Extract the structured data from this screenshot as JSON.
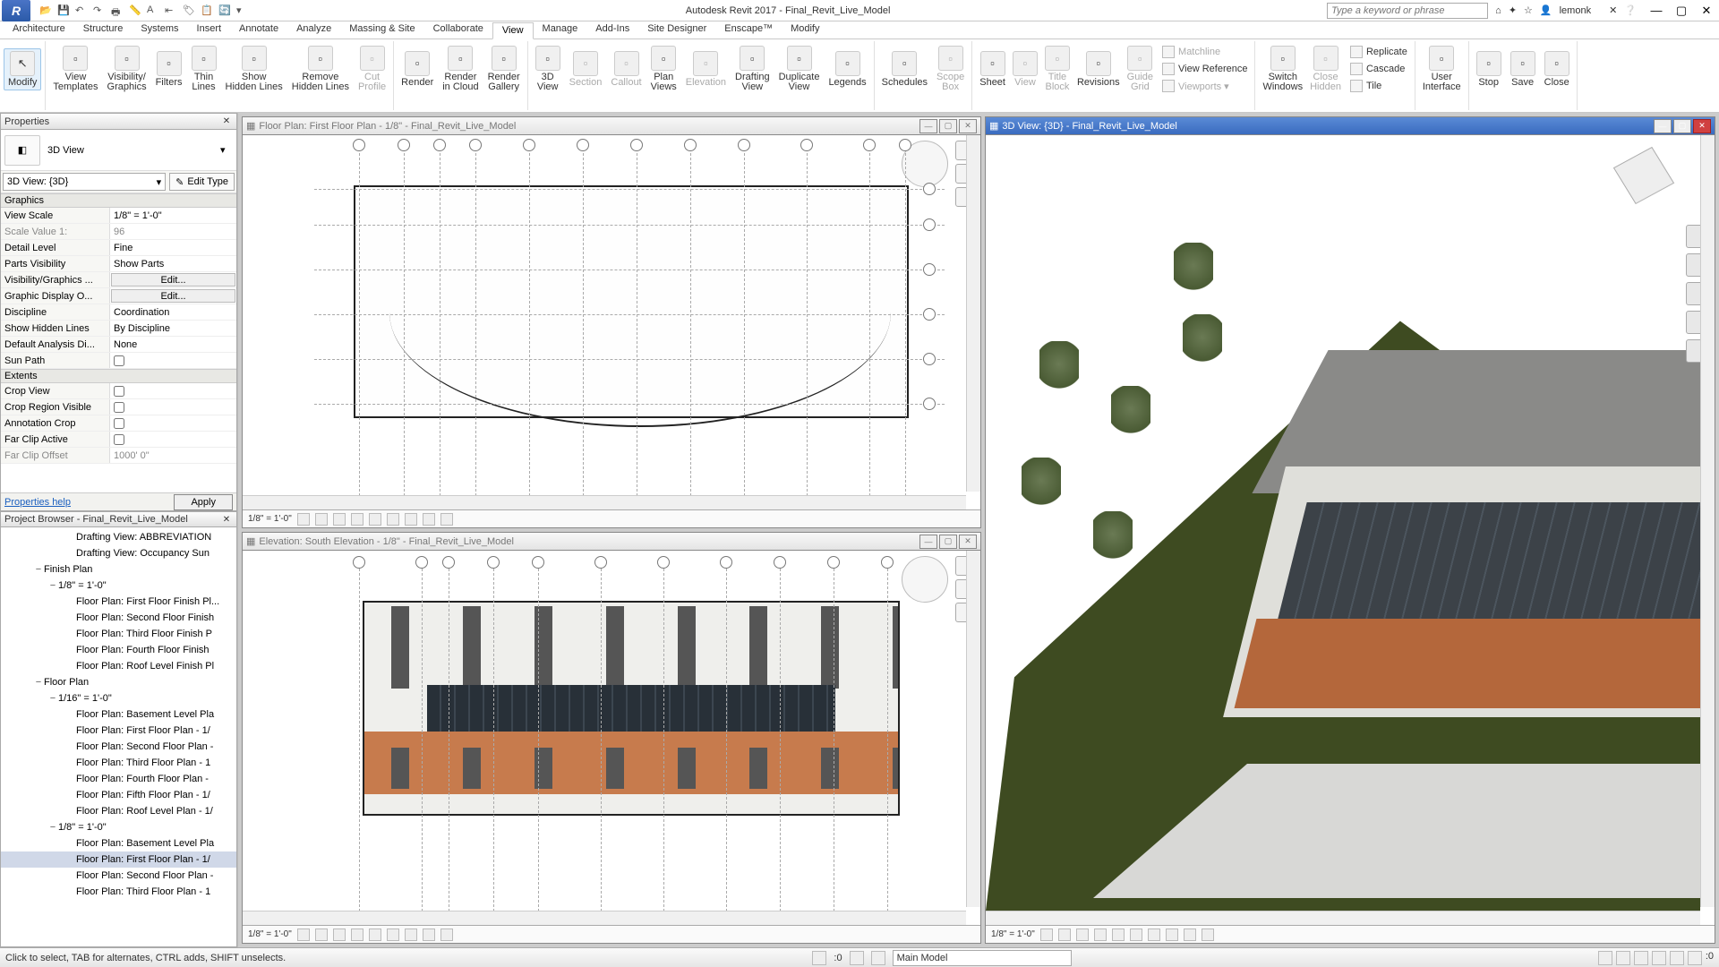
{
  "titlebar": {
    "app_title": "Autodesk Revit 2017 -    Final_Revit_Live_Model",
    "search_placeholder": "Type a keyword or phrase",
    "username": "lemonk"
  },
  "qat_icons": [
    "open-icon",
    "save-icon",
    "undo-icon",
    "redo-icon",
    "print-icon",
    "measure-icon",
    "text-icon",
    "aligned-dim-icon",
    "tag-icon",
    "paste-icon",
    "sync-icon",
    "dropdown-icon"
  ],
  "menutabs": [
    "Architecture",
    "Structure",
    "Systems",
    "Insert",
    "Annotate",
    "Analyze",
    "Massing & Site",
    "Collaborate",
    "View",
    "Manage",
    "Add-Ins",
    "Site Designer",
    "Enscape™",
    "Modify"
  ],
  "active_tab": "View",
  "ribbon": {
    "modify": "Modify",
    "graphics": [
      {
        "label": "View\nTemplates",
        "name": "view-templates"
      },
      {
        "label": "Visibility/\nGraphics",
        "name": "visibility-graphics"
      },
      {
        "label": "Filters",
        "name": "filters"
      },
      {
        "label": "Thin\nLines",
        "name": "thin-lines"
      },
      {
        "label": "Show\nHidden Lines",
        "name": "show-hidden-lines"
      },
      {
        "label": "Remove\nHidden Lines",
        "name": "remove-hidden-lines"
      },
      {
        "label": "Cut\nProfile",
        "name": "cut-profile",
        "disabled": true
      }
    ],
    "presentation": [
      {
        "label": "Render",
        "name": "render"
      },
      {
        "label": "Render\nin Cloud",
        "name": "render-in-cloud"
      },
      {
        "label": "Render\nGallery",
        "name": "render-gallery"
      }
    ],
    "create1": [
      {
        "label": "3D\nView",
        "name": "3d-view"
      },
      {
        "label": "Section",
        "name": "section",
        "disabled": true
      },
      {
        "label": "Callout",
        "name": "callout",
        "disabled": true
      },
      {
        "label": "Plan\nViews",
        "name": "plan-views"
      },
      {
        "label": "Elevation",
        "name": "elevation",
        "disabled": true
      },
      {
        "label": "Drafting\nView",
        "name": "drafting-view"
      },
      {
        "label": "Duplicate\nView",
        "name": "duplicate-view"
      },
      {
        "label": "Legends",
        "name": "legends"
      }
    ],
    "create2": [
      {
        "label": "Schedules",
        "name": "schedules"
      },
      {
        "label": "Scope\nBox",
        "name": "scope-box",
        "disabled": true
      }
    ],
    "sheet": [
      {
        "label": "Sheet",
        "name": "sheet"
      },
      {
        "label": "View",
        "name": "view-place",
        "disabled": true
      },
      {
        "label": "Title\nBlock",
        "name": "title-block",
        "disabled": true
      },
      {
        "label": "Revisions",
        "name": "revisions"
      },
      {
        "label": "Guide\nGrid",
        "name": "guide-grid",
        "disabled": true
      }
    ],
    "sheet_small": [
      {
        "label": "Matchline",
        "name": "matchline",
        "disabled": true
      },
      {
        "label": "View Reference",
        "name": "view-reference"
      },
      {
        "label": "Viewports ▾",
        "name": "viewports",
        "disabled": true
      }
    ],
    "windows_main": [
      {
        "label": "Switch\nWindows",
        "name": "switch-windows"
      },
      {
        "label": "Close\nHidden",
        "name": "close-hidden",
        "disabled": true
      }
    ],
    "windows_small": [
      {
        "label": "Replicate",
        "name": "replicate"
      },
      {
        "label": "Cascade",
        "name": "cascade"
      },
      {
        "label": "Tile",
        "name": "tile"
      }
    ],
    "ui": [
      {
        "label": "User\nInterface",
        "name": "user-interface"
      }
    ],
    "live": [
      {
        "label": "Stop",
        "name": "live-stop"
      },
      {
        "label": "Save",
        "name": "live-save"
      },
      {
        "label": "Close",
        "name": "live-close"
      }
    ]
  },
  "properties": {
    "panel_title": "Properties",
    "type_name": "3D View",
    "instance": "3D View: {3D}",
    "edit_type": "Edit Type",
    "groups": [
      {
        "head": "Graphics",
        "rows": [
          {
            "l": "View Scale",
            "v": "1/8\" = 1'-0\""
          },
          {
            "l": "Scale Value    1:",
            "v": "96",
            "ro": true
          },
          {
            "l": "Detail Level",
            "v": "Fine"
          },
          {
            "l": "Parts Visibility",
            "v": "Show Parts"
          },
          {
            "l": "Visibility/Graphics ...",
            "v": "Edit...",
            "btn": true
          },
          {
            "l": "Graphic Display O...",
            "v": "Edit...",
            "btn": true
          },
          {
            "l": "Discipline",
            "v": "Coordination"
          },
          {
            "l": "Show Hidden Lines",
            "v": "By Discipline"
          },
          {
            "l": "Default Analysis Di...",
            "v": "None"
          },
          {
            "l": "Sun Path",
            "v": "",
            "chk": true
          }
        ]
      },
      {
        "head": "Extents",
        "rows": [
          {
            "l": "Crop View",
            "v": "",
            "chk": true
          },
          {
            "l": "Crop Region Visible",
            "v": "",
            "chk": true
          },
          {
            "l": "Annotation Crop",
            "v": "",
            "chk": true
          },
          {
            "l": "Far Clip Active",
            "v": "",
            "chk": true
          },
          {
            "l": "Far Clip Offset",
            "v": "1000' 0\"",
            "ro": true
          }
        ]
      }
    ],
    "help": "Properties help",
    "apply": "Apply"
  },
  "browser": {
    "panel_title": "Project Browser - Final_Revit_Live_Model",
    "nodes": [
      {
        "t": "Drafting View: ABBREVIATION",
        "cls": "ind4"
      },
      {
        "t": "Drafting View: Occupancy Sun",
        "cls": "ind4"
      },
      {
        "t": "Finish Plan",
        "cls": "ind1",
        "tw": "−"
      },
      {
        "t": "1/8\" = 1'-0\"",
        "cls": "ind2",
        "tw": "−"
      },
      {
        "t": "Floor Plan: First Floor Finish Pl...",
        "cls": "ind4"
      },
      {
        "t": "Floor Plan: Second Floor Finish",
        "cls": "ind4"
      },
      {
        "t": "Floor Plan: Third Floor Finish P",
        "cls": "ind4"
      },
      {
        "t": "Floor Plan: Fourth Floor Finish",
        "cls": "ind4"
      },
      {
        "t": "Floor Plan: Roof Level Finish Pl",
        "cls": "ind4"
      },
      {
        "t": "Floor Plan",
        "cls": "ind1",
        "tw": "−"
      },
      {
        "t": "1/16\" = 1'-0\"",
        "cls": "ind2",
        "tw": "−"
      },
      {
        "t": "Floor Plan: Basement Level Pla",
        "cls": "ind4"
      },
      {
        "t": "Floor Plan: First Floor Plan - 1/",
        "cls": "ind4"
      },
      {
        "t": "Floor Plan: Second Floor Plan -",
        "cls": "ind4"
      },
      {
        "t": "Floor Plan: Third Floor Plan - 1",
        "cls": "ind4"
      },
      {
        "t": "Floor Plan: Fourth Floor Plan -",
        "cls": "ind4"
      },
      {
        "t": "Floor Plan: Fifth Floor Plan - 1/",
        "cls": "ind4"
      },
      {
        "t": "Floor Plan: Roof Level Plan - 1/",
        "cls": "ind4"
      },
      {
        "t": "1/8\" = 1'-0\"",
        "cls": "ind2",
        "tw": "−"
      },
      {
        "t": "Floor Plan: Basement Level Pla",
        "cls": "ind4"
      },
      {
        "t": "Floor Plan: First Floor Plan - 1/",
        "cls": "ind4",
        "sel": true
      },
      {
        "t": "Floor Plan: Second Floor Plan -",
        "cls": "ind4"
      },
      {
        "t": "Floor Plan: Third Floor Plan - 1",
        "cls": "ind4"
      }
    ]
  },
  "views": {
    "floorplan": {
      "title": "Floor Plan: First Floor Plan - 1/8\" - Final_Revit_Live_Model",
      "scale": "1/8\" = 1'-0\""
    },
    "elevation": {
      "title": "Elevation: South Elevation - 1/8\" - Final_Revit_Live_Model",
      "scale": "1/8\" = 1'-0\""
    },
    "three_d": {
      "title": "3D View: {3D} - Final_Revit_Live_Model",
      "scale": "1/8\" = 1'-0\""
    }
  },
  "status": {
    "hint": "Click to select, TAB for alternates, CTRL adds, SHIFT unselects.",
    "count": ":0",
    "workset": "Main Model"
  }
}
